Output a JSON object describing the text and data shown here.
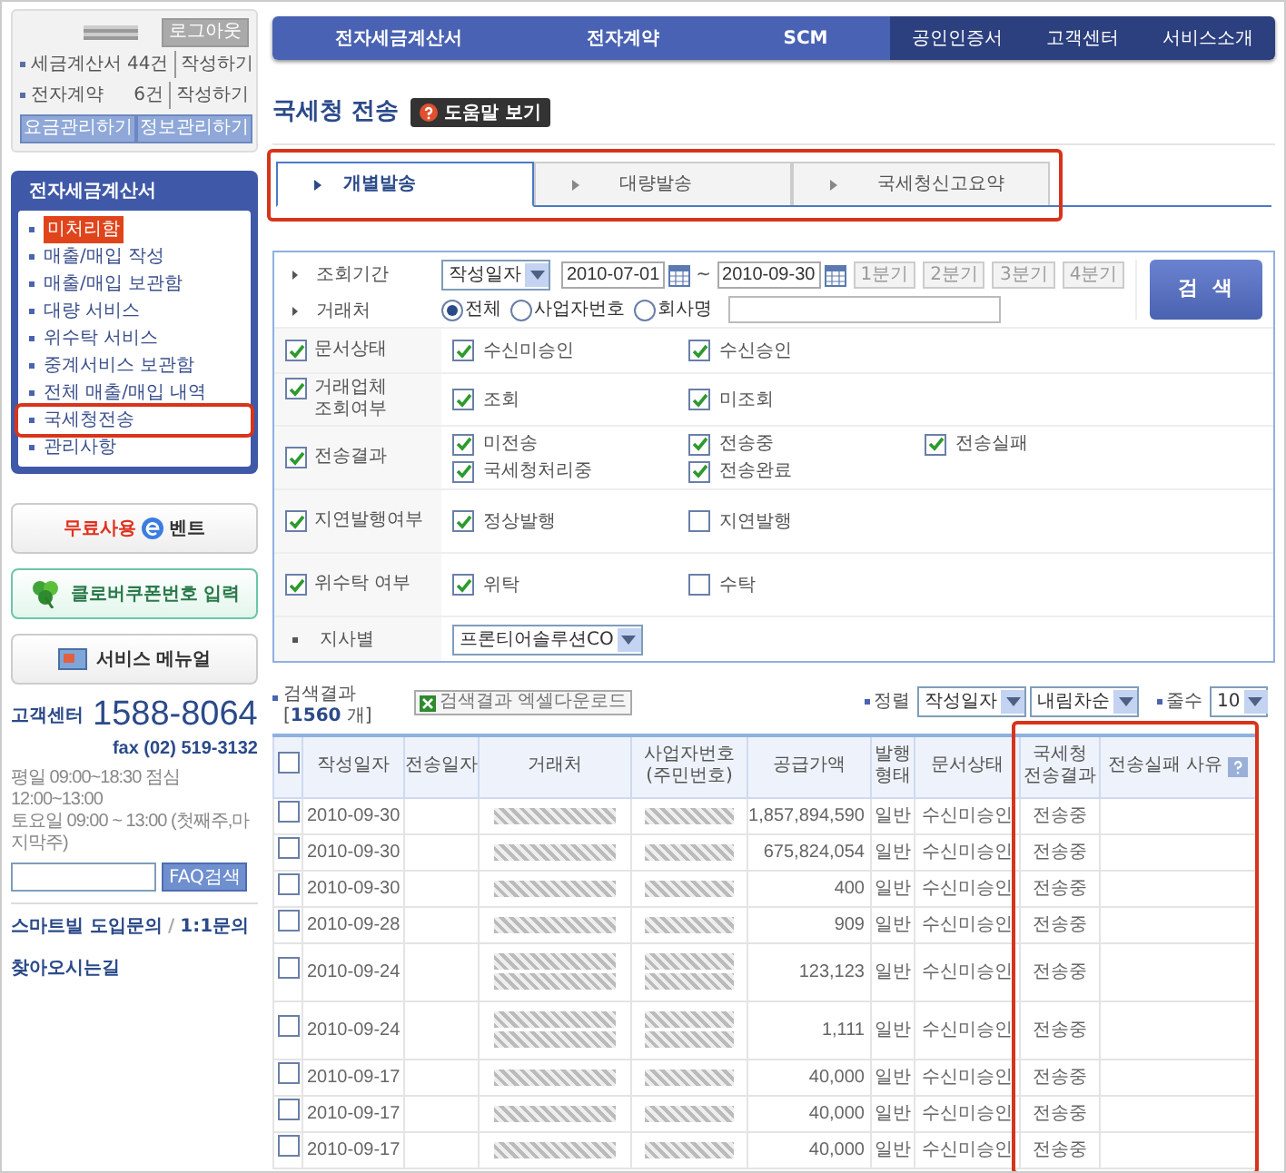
{
  "account": {
    "logout": "로그아웃",
    "rows": [
      {
        "label": "세금계산서",
        "count": "44건",
        "action": "작성하기"
      },
      {
        "label": "전자계약",
        "count": "6건",
        "action": "작성하기"
      }
    ],
    "buttons": [
      "요금관리하기",
      "정보관리하기"
    ]
  },
  "menu": {
    "title": "전자세금계산서",
    "items": [
      {
        "label": "미처리함",
        "emphasis": true,
        "highlighted": false
      },
      {
        "label": "매출/매입 작성",
        "emphasis": false,
        "highlighted": false
      },
      {
        "label": "매출/매입 보관함",
        "emphasis": false,
        "highlighted": false
      },
      {
        "label": "대량 서비스",
        "emphasis": false,
        "highlighted": false
      },
      {
        "label": "위수탁 서비스",
        "emphasis": false,
        "highlighted": false
      },
      {
        "label": "중계서비스 보관함",
        "emphasis": false,
        "highlighted": false
      },
      {
        "label": "전체 매출/매입 내역",
        "emphasis": false,
        "highlighted": false
      },
      {
        "label": "국세청전송",
        "emphasis": false,
        "highlighted": true
      },
      {
        "label": "관리사항",
        "emphasis": false,
        "highlighted": false
      }
    ]
  },
  "promos": [
    {
      "kind": "event",
      "text": "무료사용",
      "text_2": "벤트"
    },
    {
      "kind": "coupon",
      "text": "클로버쿠폰번호 입력"
    },
    {
      "kind": "manual",
      "text": "서비스 메뉴얼"
    }
  ],
  "support": {
    "label": "고객센터",
    "phone": "1588-8064",
    "fax": "fax (02) 519-3132",
    "hours": [
      "평일 09:00~18:30  점심 12:00~13:00",
      "토요일 09:00 ~ 13:00 (첫째주,마지막주)"
    ],
    "faq_button": "FAQ검색"
  },
  "links": [
    {
      "text": "스마트빌 도입문의"
    },
    {
      "text": "/"
    },
    {
      "text": "1:1문의"
    }
  ],
  "directions": "찾아오시는길",
  "top_nav": {
    "primary": [
      "전자세금계산서",
      "전자계약",
      "SCM"
    ],
    "secondary": [
      "공인인증서",
      "고객센터",
      "서비스소개"
    ]
  },
  "page_title": "국세청 전송",
  "help_button": "도움말 보기",
  "tabs": {
    "highlighted": true,
    "items": [
      {
        "label": "개별발송",
        "selected": true
      },
      {
        "label": "대량발송",
        "selected": false
      },
      {
        "label": "국세청신고요약",
        "selected": false
      }
    ]
  },
  "filters": {
    "period": {
      "label": "조회기간",
      "select": "작성일자",
      "from": "2010-07-01",
      "separator": "~",
      "to": "2010-09-30",
      "quarters": [
        "1분기",
        "2분기",
        "3분기",
        "4분기"
      ]
    },
    "partner": {
      "label": "거래처",
      "options": [
        {
          "label": "전체",
          "selected": true
        },
        {
          "label": "사업자번호",
          "selected": false
        },
        {
          "label": "회사명",
          "selected": false
        }
      ]
    },
    "search_button": "검  색",
    "groups": [
      {
        "label": "문서상태",
        "checked": true,
        "options": [
          {
            "label": "수신미승인",
            "checked": true
          },
          {
            "label": "수신승인",
            "checked": true
          }
        ]
      },
      {
        "label": "거래업체\n조회여부",
        "checked": true,
        "options": [
          {
            "label": "조회",
            "checked": true
          },
          {
            "label": "미조회",
            "checked": true
          }
        ]
      },
      {
        "label": "전송결과",
        "checked": true,
        "options": [
          {
            "label": "미전송",
            "checked": true
          },
          {
            "label": "전송중",
            "checked": true
          },
          {
            "label": "전송실패",
            "checked": true
          },
          {
            "label": "국세청처리중",
            "checked": true
          },
          {
            "label": "전송완료",
            "checked": true
          }
        ]
      },
      {
        "label": "지연발행여부",
        "checked": true,
        "options": [
          {
            "label": "정상발행",
            "checked": true
          },
          {
            "label": "지연발행",
            "checked": false
          }
        ]
      },
      {
        "label": "위수탁 여부",
        "checked": true,
        "options": [
          {
            "label": "위탁",
            "checked": true
          },
          {
            "label": "수탁",
            "checked": false
          }
        ]
      }
    ],
    "branch": {
      "label": "지사별",
      "value": "프론티어솔루션CO"
    }
  },
  "results": {
    "summary": "검색결과[**1560** 개]",
    "excel_button": "검색결과 엑셀다운로드",
    "sort_label": "정렬",
    "sort_field": "작성일자",
    "sort_order": "내림차순",
    "rows_label": "줄수",
    "rows_value": "10"
  },
  "table": {
    "all_checked": false,
    "result_columns_highlighted": true,
    "columns": [
      {
        "label": "작성일자"
      },
      {
        "label": "전송일자"
      },
      {
        "label": "거래처"
      },
      {
        "label": "사업자번호\n(주민번호)"
      },
      {
        "label": "공급가액"
      },
      {
        "label": "발행\n형태"
      },
      {
        "label": "문서상태"
      },
      {
        "label": "국세청\n전송결과"
      },
      {
        "label": "전송실패 사유"
      }
    ],
    "rows": [
      {
        "date": "2010-09-30",
        "amount": "1,857,894,590",
        "type": "일반",
        "status": "수신미승인",
        "result": "전송중",
        "tall": false,
        "checked": false
      },
      {
        "date": "2010-09-30",
        "amount": "675,824,054",
        "type": "일반",
        "status": "수신미승인",
        "result": "전송중",
        "tall": false,
        "checked": false
      },
      {
        "date": "2010-09-30",
        "amount": "400",
        "type": "일반",
        "status": "수신미승인",
        "result": "전송중",
        "tall": false,
        "checked": false
      },
      {
        "date": "2010-09-28",
        "amount": "909",
        "type": "일반",
        "status": "수신미승인",
        "result": "전송중",
        "tall": false,
        "checked": false
      },
      {
        "date": "2010-09-24",
        "amount": "123,123",
        "type": "일반",
        "status": "수신미승인",
        "result": "전송중",
        "tall": true,
        "checked": false
      },
      {
        "date": "2010-09-24",
        "amount": "1,111",
        "type": "일반",
        "status": "수신미승인",
        "result": "전송중",
        "tall": true,
        "checked": false
      },
      {
        "date": "2010-09-17",
        "amount": "40,000",
        "type": "일반",
        "status": "수신미승인",
        "result": "전송중",
        "tall": false,
        "checked": false
      },
      {
        "date": "2010-09-17",
        "amount": "40,000",
        "type": "일반",
        "status": "수신미승인",
        "result": "전송중",
        "tall": false,
        "checked": false
      },
      {
        "date": "2010-09-17",
        "amount": "40,000",
        "type": "일반",
        "status": "수신미승인",
        "result": "전송중",
        "tall": false,
        "checked": false
      }
    ]
  }
}
